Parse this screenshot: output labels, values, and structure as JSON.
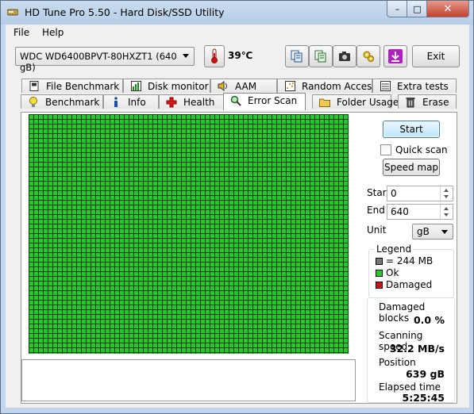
{
  "window": {
    "title": "HD Tune Pro 5.50 - Hard Disk/SSD Utility",
    "min_glyph": "–",
    "max_glyph": "□",
    "close_glyph": "✕"
  },
  "menu": {
    "file": "File",
    "help": "Help"
  },
  "toolbar": {
    "drive": "WDC WD6400BPVT-80HXZT1 (640 gB)",
    "temperature": "39℃",
    "exit_label": "Exit",
    "icons": [
      "thermometer-icon",
      "copy-text-icon",
      "copy-info-icon",
      "camera-icon",
      "options-icon",
      "download-icon"
    ]
  },
  "tabs_top": [
    {
      "label": "File Benchmark",
      "icon": "file-benchmark-icon"
    },
    {
      "label": "Disk monitor",
      "icon": "disk-monitor-icon"
    },
    {
      "label": "AAM",
      "icon": "speaker-icon"
    },
    {
      "label": "Random Access",
      "icon": "random-access-icon"
    },
    {
      "label": "Extra tests",
      "icon": "extra-tests-icon"
    }
  ],
  "tabs_bottom": [
    {
      "label": "Benchmark",
      "icon": "bulb-icon"
    },
    {
      "label": "Info",
      "icon": "info-icon"
    },
    {
      "label": "Health",
      "icon": "health-cross-icon"
    },
    {
      "label": "Error Scan",
      "icon": "magnifier-icon",
      "active": true
    },
    {
      "label": "Folder Usage",
      "icon": "folder-icon"
    },
    {
      "label": "Erase",
      "icon": "trash-icon"
    }
  ],
  "scan": {
    "start_label": "Start",
    "quick_scan_label": "Quick scan",
    "quick_scan_checked": false,
    "speed_map_label": "Speed map",
    "start_field_label": "Start",
    "start_value": "0",
    "end_field_label": "End",
    "end_value": "640",
    "unit_label": "Unit",
    "unit_value": "gB",
    "block_status": "ok",
    "colors": {
      "ok": "#22cc22",
      "damaged": "#cc1111",
      "unit": "#777777",
      "grid": "#0b3d0b"
    }
  },
  "legend": {
    "title": "Legend",
    "unit_text": "= 244 MB",
    "ok_text": "Ok",
    "damaged_text": "Damaged"
  },
  "stats": {
    "damaged_label": "Damaged blocks",
    "damaged_value": "0.0 %",
    "speed_label": "Scanning speed",
    "speed_value": "32.2 MB/s",
    "position_label": "Position",
    "position_value": "639 gB",
    "elapsed_label": "Elapsed time",
    "elapsed_value": "5:25:45"
  }
}
